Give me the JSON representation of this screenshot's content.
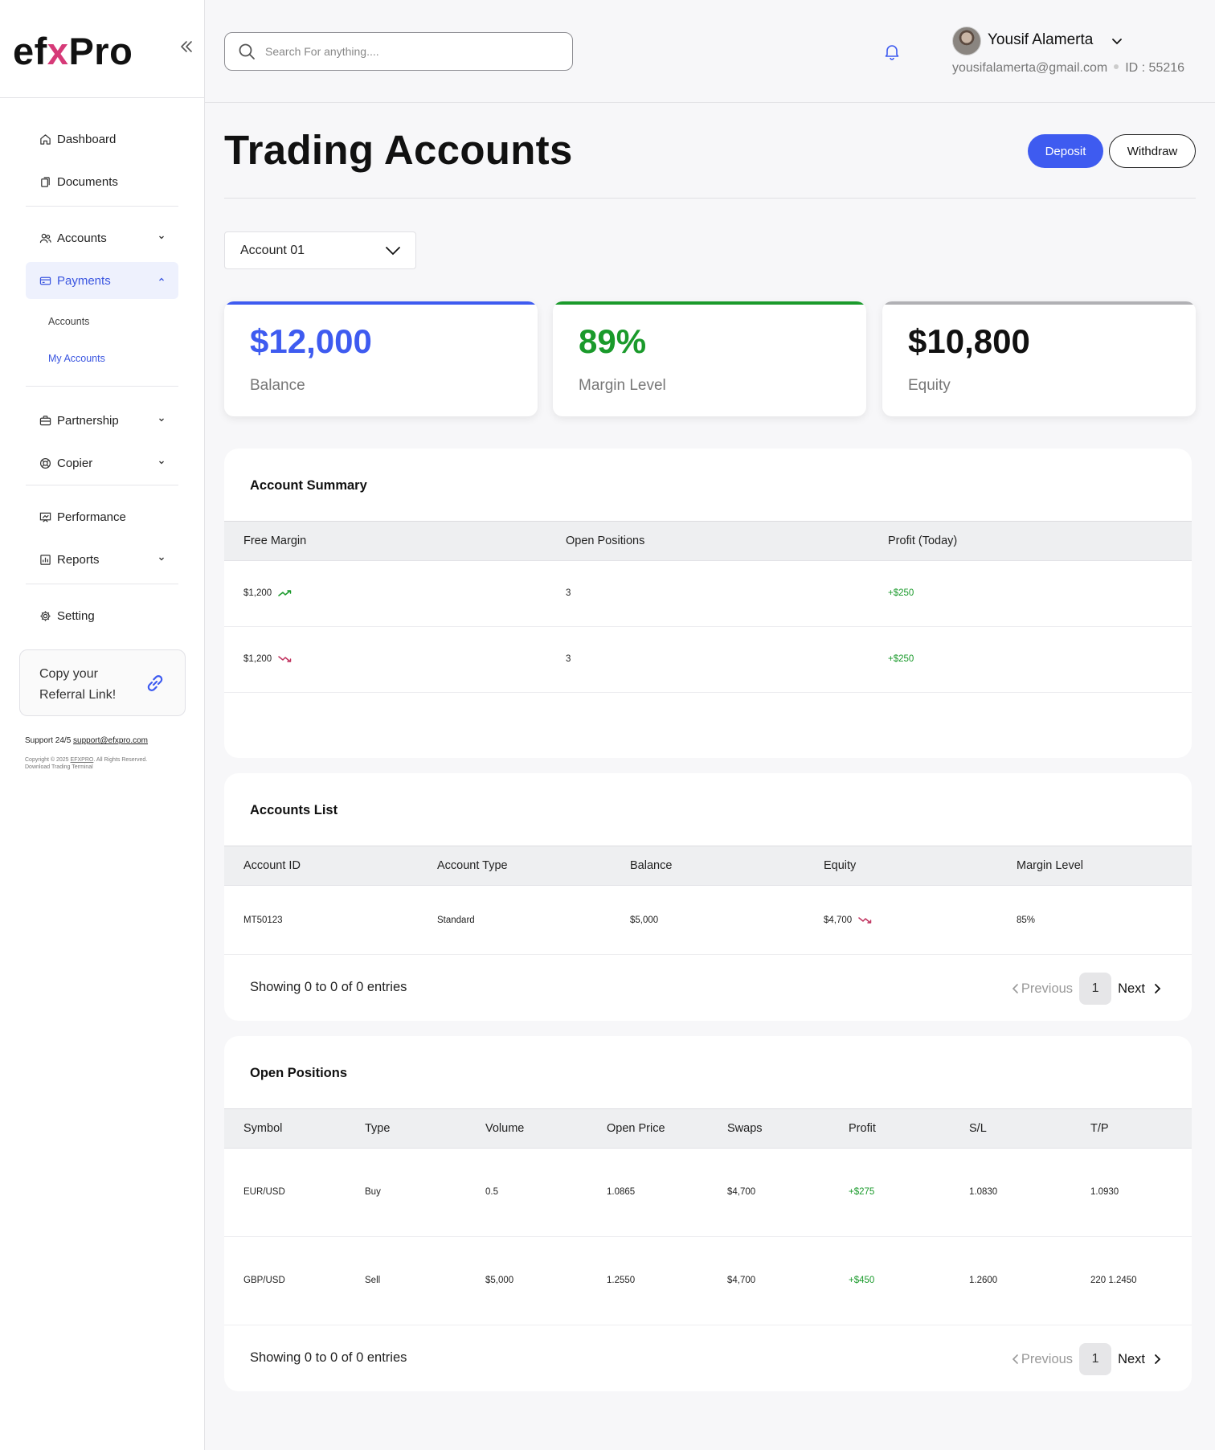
{
  "brand": {
    "logo_prefix": "ef",
    "logo_x": "x",
    "logo_suffix": "Pro",
    "accent": "#3e5bf0",
    "logo_x_color": "#d63a78"
  },
  "sidebar": {
    "items": [
      {
        "label": "Dashboard",
        "icon": "home-icon"
      },
      {
        "label": "Documents",
        "icon": "documents-icon"
      },
      {
        "label": "Accounts",
        "icon": "users-icon"
      },
      {
        "label": "Payments",
        "icon": "card-icon"
      },
      {
        "label": "Partnership",
        "icon": "briefcase-icon"
      },
      {
        "label": "Copier",
        "icon": "lifebuoy-icon"
      },
      {
        "label": "Performance",
        "icon": "presentation-icon"
      },
      {
        "label": "Reports",
        "icon": "report-icon"
      },
      {
        "label": "Setting",
        "icon": "gear-icon"
      }
    ],
    "sub_items": [
      "Accounts",
      "My Accounts"
    ],
    "referral": {
      "line1": "Copy your",
      "line2": "Referral Link!"
    },
    "support_label": "Support 24/5",
    "support_email": "support@efxpro.com",
    "copyright_prefix": "Copyright © 2025",
    "copyright_brand": "EFXPRO",
    "copyright_suffix": ". All Rights Reserved.",
    "download_label": "Download Trading Terminal"
  },
  "header": {
    "search_placeholder": "Search For anything....",
    "user_name": "Yousif Alamerta",
    "user_email": "yousifalamerta@gmail.com",
    "user_id": "ID : 55216"
  },
  "page": {
    "title": "Trading Accounts",
    "deposit_label": "Deposit",
    "withdraw_label": "Withdraw",
    "account_select": "Account 01"
  },
  "stats": [
    {
      "value": "$12,000",
      "label": "Balance",
      "color": "#3e5bf0"
    },
    {
      "value": "89%",
      "label": "Margin Level",
      "color": "#1a9a2b"
    },
    {
      "value": "$10,800",
      "label": "Equity",
      "color": "#111111",
      "bar_color": "#b0b0b4"
    }
  ],
  "account_summary": {
    "title": "Account Summary",
    "headers": [
      "Free Margin",
      "Open Positions",
      "Profit (Today)"
    ],
    "rows": [
      {
        "free_margin": "$1,200",
        "trend": "up",
        "open_positions": "3",
        "profit": "+$250"
      },
      {
        "free_margin": "$1,200",
        "trend": "down",
        "open_positions": "3",
        "profit": "+$250"
      }
    ]
  },
  "accounts_list": {
    "title": "Accounts List",
    "headers": [
      "Account ID",
      "Account Type",
      "Balance",
      "Equity",
      "Margin Level"
    ],
    "rows": [
      {
        "id": "MT50123",
        "type": "Standard",
        "balance": "$5,000",
        "equity": "$4,700",
        "trend": "down",
        "margin": "85%"
      }
    ],
    "showing": "Showing 0 to 0 of 0 entries",
    "previous": "Previous",
    "page": "1",
    "next": "Next"
  },
  "open_positions": {
    "title": "Open Positions",
    "headers": [
      "Symbol",
      "Type",
      "Volume",
      "Open Price",
      "Swaps",
      "Profit",
      "S/L",
      "T/P"
    ],
    "rows": [
      [
        "EUR/USD",
        "Buy",
        "0.5",
        "1.0865",
        "$4,700",
        "+$275",
        "1.0830",
        "1.0930"
      ],
      [
        "GBP/USD",
        "Sell",
        "$5,000",
        "1.2550",
        "$4,700",
        "+$450",
        "1.2600",
        "220 1.2450"
      ]
    ],
    "showing": "Showing 0 to 0 of 0 entries",
    "previous": "Previous",
    "page": "1",
    "next": "Next"
  }
}
